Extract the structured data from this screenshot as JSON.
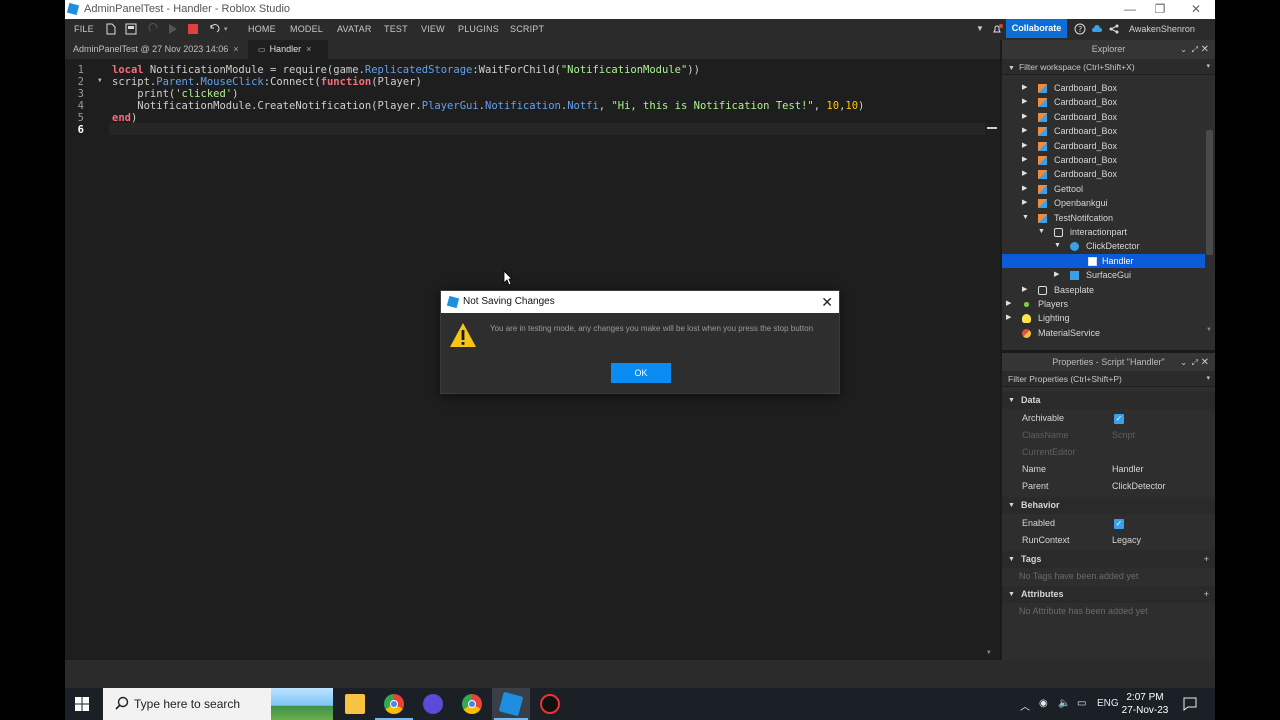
{
  "window": {
    "title": "AdminPanelTest - Handler - Roblox Studio",
    "controls": {
      "minimize": "—",
      "restore": "❐",
      "close": "✕"
    }
  },
  "menubar": {
    "file": "FILE",
    "tabs": [
      "HOME",
      "MODEL",
      "AVATAR",
      "TEST",
      "VIEW",
      "PLUGINS",
      "SCRIPT"
    ],
    "collaborate": "Collaborate",
    "username": "AwakenShenron"
  },
  "editor_tabs": [
    {
      "label": "AdminPanelTest @ 27 Nov 2023 14:06",
      "close": "×"
    },
    {
      "label": "Handler",
      "close": "×"
    }
  ],
  "code": {
    "line_numbers": [
      "1",
      "2",
      "3",
      "4",
      "5",
      "6"
    ],
    "line1": {
      "k1": "local",
      "t1": " NotificationModule = require(game.",
      "p1": "ReplicatedStorage",
      "t2": ":WaitForChild(",
      "s1": "\"NotificationModule\"",
      "t3": "))"
    },
    "line2": {
      "t1": "script.",
      "p1": "Parent",
      "t2": ".",
      "p2": "MouseClick",
      "t3": ":Connect(",
      "k1": "function",
      "t4": "(Player)"
    },
    "line3": {
      "t1": "    print(",
      "s1": "'clicked'",
      "t2": ")"
    },
    "line4": {
      "t1": "    NotificationModule.CreateNotification(Player.",
      "p1": "PlayerGui",
      "t2": ".",
      "p2": "Notification",
      "t3": ".",
      "p3": "Notfi",
      "t4": ", ",
      "s1": "\"Hi, this is Notification Test!\"",
      "t5": ", ",
      "n1": "10",
      "t6": ",",
      "n2": "10",
      "t7": ")"
    },
    "line5": {
      "k1": "end",
      "t1": ")"
    }
  },
  "explorer": {
    "title": "Explorer",
    "filter_placeholder": "Filter workspace (Ctrl+Shift+X)",
    "items": [
      {
        "label": "Cardboard_Box",
        "icon": "model-icon"
      },
      {
        "label": "Cardboard_Box",
        "icon": "model-icon"
      },
      {
        "label": "Cardboard_Box",
        "icon": "model-icon"
      },
      {
        "label": "Cardboard_Box",
        "icon": "model-icon"
      },
      {
        "label": "Cardboard_Box",
        "icon": "model-icon"
      },
      {
        "label": "Cardboard_Box",
        "icon": "model-icon"
      },
      {
        "label": "Cardboard_Box",
        "icon": "model-icon"
      },
      {
        "label": "Gettool",
        "icon": "model-icon"
      },
      {
        "label": "Openbankgui",
        "icon": "model-icon"
      },
      {
        "label": "TestNotifcation",
        "icon": "model-icon"
      },
      {
        "label": "interactionpart",
        "icon": "part-icon"
      },
      {
        "label": "ClickDetector",
        "icon": "click-detector-icon"
      },
      {
        "label": "Handler",
        "icon": "script-icon"
      },
      {
        "label": "SurfaceGui",
        "icon": "surface-gui-icon"
      },
      {
        "label": "Baseplate",
        "icon": "part-icon"
      },
      {
        "label": "Players",
        "icon": "players-icon"
      },
      {
        "label": "Lighting",
        "icon": "lighting-icon"
      },
      {
        "label": "MaterialService",
        "icon": "material-service-icon"
      }
    ]
  },
  "properties": {
    "title": "Properties - Script \"Handler\"",
    "filter_placeholder": "Filter Properties (Ctrl+Shift+P)",
    "sections": {
      "data": "Data",
      "behavior": "Behavior",
      "tags": "Tags",
      "attributes": "Attributes"
    },
    "rows": {
      "archivable": "Archivable",
      "classname": "ClassName",
      "classname_value": "Script",
      "currenteditor": "CurrentEditor",
      "name": "Name",
      "name_value": "Handler",
      "parent": "Parent",
      "parent_value": "ClickDetector",
      "enabled": "Enabled",
      "runcontext": "RunContext",
      "runcontext_value": "Legacy"
    },
    "tags_empty": "No Tags have been added yet",
    "attributes_empty": "No Attribute has been added yet"
  },
  "dialog": {
    "title": "Not Saving Changes",
    "message": "You are in testing mode, any changes you make will be lost when you press the stop button",
    "ok": "OK"
  },
  "taskbar": {
    "search_placeholder": "Type here to search",
    "language": "ENG",
    "time": "2:07 PM",
    "date": "27-Nov-23"
  },
  "colors": {
    "accent": "#0d6ed8",
    "selection": "#0b5ad7",
    "ok_button": "#0a8cf3",
    "keyword": "#f86d7c",
    "string": "#adf195",
    "property": "#61a1f1",
    "number": "#ffc600"
  }
}
